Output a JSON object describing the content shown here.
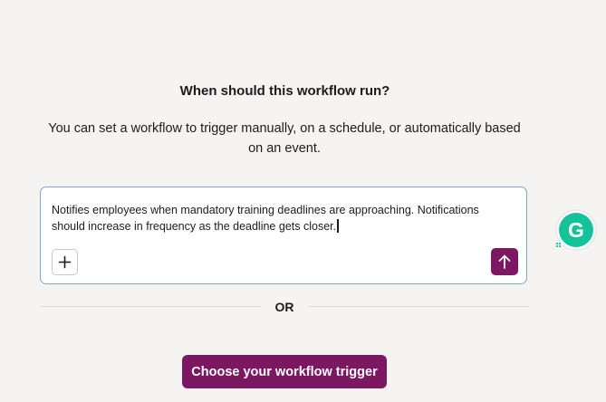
{
  "heading": "When should this workflow run?",
  "description": "You can set a workflow to trigger manually, on a schedule, or automatically based on an event.",
  "composer": {
    "value": "Notifies employees when mandatory training deadlines are approaching. Notifications should increase in frequency as the deadline gets closer.",
    "add_icon": "plus-icon",
    "send_icon": "arrow-up-icon"
  },
  "divider_label": "OR",
  "trigger_button_label": "Choose your workflow trigger",
  "grammarly": {
    "icon": "grammarly-g-icon",
    "letter": "G"
  },
  "colors": {
    "accent": "#7c1762",
    "background": "#f6f4f2",
    "focus_border": "#7ba8d6",
    "grammarly": "#15c39a"
  }
}
